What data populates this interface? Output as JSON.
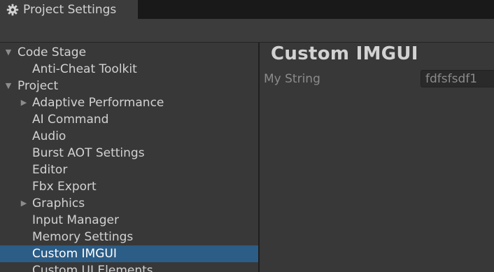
{
  "window": {
    "tab_title": "Project Settings",
    "tab_icon": "gear-icon"
  },
  "sidebar": {
    "items": [
      {
        "label": "Code Stage",
        "level": 0,
        "expander": "expanded"
      },
      {
        "label": "Anti-Cheat Toolkit",
        "level": 1,
        "expander": "none"
      },
      {
        "label": "Project",
        "level": 0,
        "expander": "expanded"
      },
      {
        "label": "Adaptive Performance",
        "level": 1,
        "expander": "collapsed"
      },
      {
        "label": "AI Command",
        "level": 1,
        "expander": "none"
      },
      {
        "label": "Audio",
        "level": 1,
        "expander": "none"
      },
      {
        "label": "Burst AOT Settings",
        "level": 1,
        "expander": "none"
      },
      {
        "label": "Editor",
        "level": 1,
        "expander": "none"
      },
      {
        "label": "Fbx Export",
        "level": 1,
        "expander": "none"
      },
      {
        "label": "Graphics",
        "level": 1,
        "expander": "collapsed"
      },
      {
        "label": "Input Manager",
        "level": 1,
        "expander": "none"
      },
      {
        "label": "Memory Settings",
        "level": 1,
        "expander": "none"
      },
      {
        "label": "Custom IMGUI",
        "level": 1,
        "expander": "none",
        "selected": true
      },
      {
        "label": "Custom UI Elements",
        "level": 1,
        "expander": "none"
      }
    ]
  },
  "main": {
    "title": "Custom IMGUI",
    "property": {
      "label": "My String",
      "value": "fdfsfsdf1"
    }
  },
  "colors": {
    "selection": "#2c5d87",
    "background": "#383838",
    "tabstrip": "#191919"
  }
}
